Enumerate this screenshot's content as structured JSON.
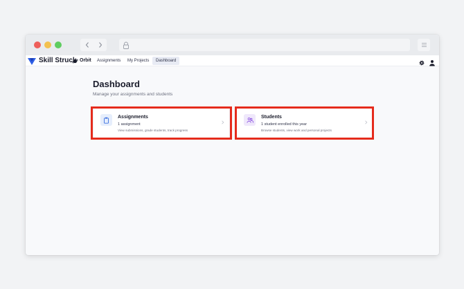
{
  "app": {
    "brand": "Skill Struck",
    "product": "Orbit",
    "nav": [
      {
        "label": "Assignments",
        "active": false
      },
      {
        "label": "My Projects",
        "active": false
      },
      {
        "label": "Dashboard",
        "active": true
      }
    ]
  },
  "browser": {
    "icons": [
      "back-arrow-icon",
      "forward-arrow-icon",
      "lock-icon",
      "hamburger-menu-icon"
    ]
  },
  "page": {
    "title": "Dashboard",
    "subtitle": "Manage your assignments and students"
  },
  "cards": [
    {
      "title": "Assignments",
      "count": "1 assignment",
      "description": "View submissions, grade students, track progress",
      "icon": "clipboard-icon",
      "icon_color": "#3b6fe0",
      "highlighted": true
    },
    {
      "title": "Students",
      "count": "1 student enrolled this year",
      "description": "Browse students, view work and personal projects",
      "icon": "students-icon",
      "icon_color": "#8a4fe0",
      "highlighted": true
    }
  ],
  "colors": {
    "highlight": "#e52b1c",
    "brand": "#2f5fe6",
    "active_nav_bg": "#e8ebf4"
  }
}
